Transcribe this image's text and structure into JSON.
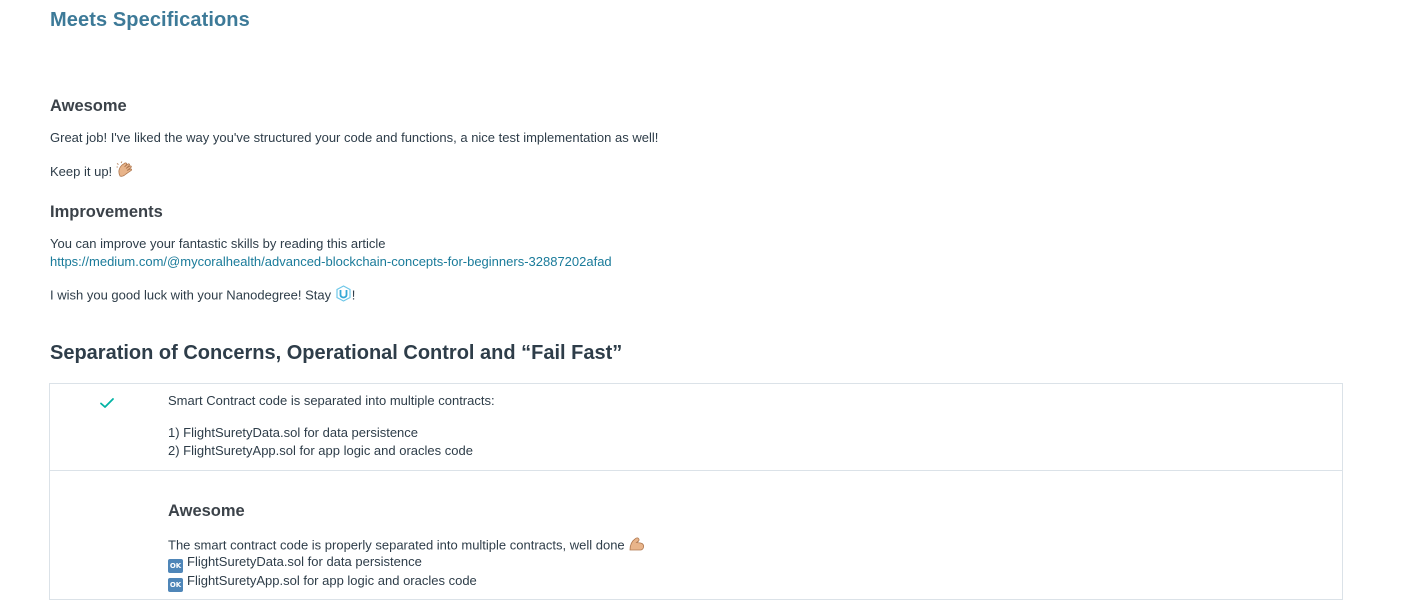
{
  "header": {
    "status": "Meets Specifications"
  },
  "review": {
    "awesome_heading": "Awesome",
    "awesome_text": "Great job! I've liked the way you've structured your code and functions, a nice test implementation as well!",
    "keep_it_up": "Keep it up!",
    "improvements_heading": "Improvements",
    "improvements_text": "You can improve your fantastic skills by reading this article",
    "improvements_link": "https://medium.com/@mycoralhealth/advanced-blockchain-concepts-for-beginners-32887202afad",
    "closing_text": "I wish you good luck with your Nanodegree! Stay",
    "closing_suffix": "!"
  },
  "section": {
    "title": "Separation of Concerns, Operational Control and “Fail Fast”",
    "criteria": {
      "status_icon": "checkmark-icon",
      "spec_text": "Smart Contract code is separated into multiple contracts:",
      "spec_items": [
        "1) FlightSuretyData.sol for data persistence",
        "2) FlightSuretyApp.sol for app logic and oracles code"
      ],
      "comment_heading": "Awesome",
      "comment_text": "The smart contract code is properly separated into multiple contracts, well done",
      "comment_items": [
        "FlightSuretyData.sol for data persistence",
        "FlightSuretyApp.sol for app logic and oracles code"
      ],
      "ok_badge": "OK"
    }
  },
  "colors": {
    "title": "#3d7a98",
    "link": "#1a7b9a",
    "check": "#02b3a4",
    "text": "#2e3d49",
    "border": "#dbe2e8"
  }
}
